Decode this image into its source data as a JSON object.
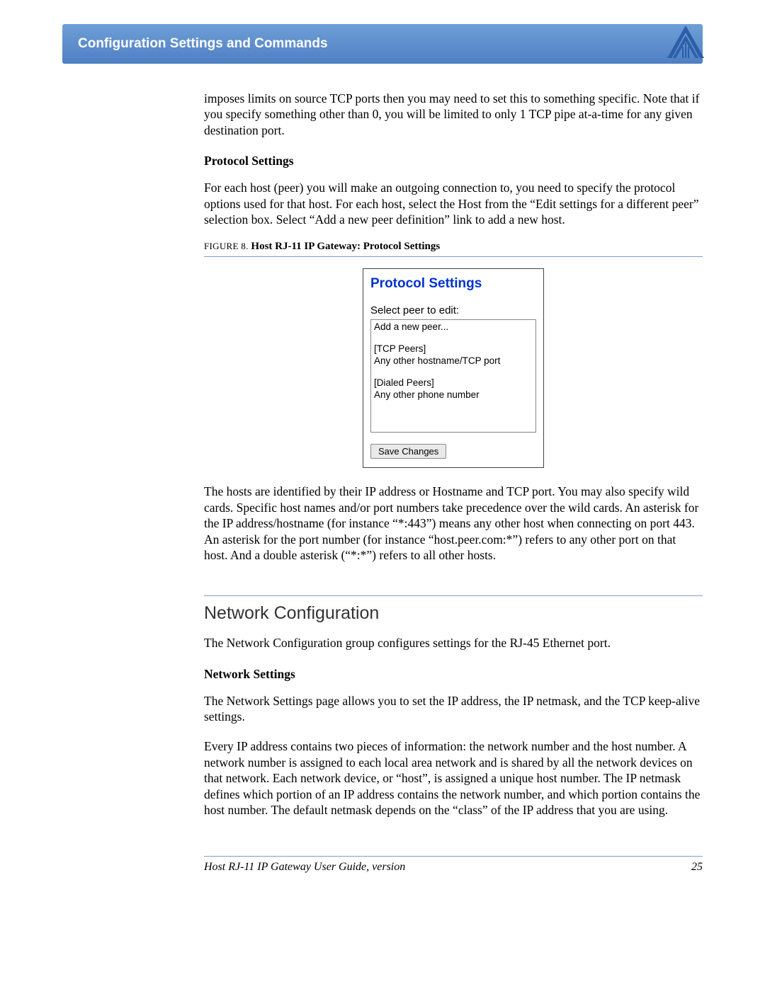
{
  "header": {
    "title": "Configuration Settings and Commands"
  },
  "body": {
    "intro_para": "imposes limits on source TCP ports then you may need to set this to something specific. Note that if you specify something other than 0, you will be limited to only 1 TCP pipe at-a-time for any given destination port.",
    "protocol_settings": {
      "heading": "Protocol Settings",
      "para": "For each host (peer) you will make an outgoing connection to, you need to specify the protocol options used for that host. For each host, select the Host from the “Edit settings for a different peer” selection box. Select “Add a new peer definition” link to add a new host.",
      "figure_label": "FIGURE 8.",
      "figure_title": "Host RJ-11 IP Gateway: Protocol Settings",
      "panel": {
        "title": "Protocol Settings",
        "select_label": "Select peer to edit:",
        "list": {
          "add": "Add a new peer...",
          "tcp_header": "[TCP Peers]",
          "tcp_item": " Any other hostname/TCP port",
          "dial_header": "[Dialed Peers]",
          "dial_item": " Any other phone number"
        },
        "save_button": "Save Changes"
      },
      "after_para": "The hosts are identified by their IP address or Hostname and TCP port. You may also specify wild cards. Specific host names and/or port numbers take precedence over the wild cards. An asterisk for the IP address/hostname (for instance “*:443”) means any other host when connecting on port 443. An asterisk for the port number (for instance “host.peer.com:*”) refers to any other port on that host. And a double asterisk (“*:*”) refers to all other hosts."
    },
    "network_configuration": {
      "section_title": "Network Configuration",
      "intro": "The Network Configuration group configures settings for the RJ-45 Ethernet port.",
      "network_settings_heading": "Network Settings",
      "ns_para1": "The Network Settings page allows you to set the IP address, the IP netmask, and the TCP keep-alive settings.",
      "ns_para2": "Every IP address contains two pieces of information: the network number and the host number. A network number is assigned to each local area network and is shared by all the network devices on that network. Each network device, or “host”, is assigned a unique host number. The IP netmask defines which portion of an IP address contains the network number, and which portion contains the host number. The default netmask depends on the “class” of the IP address that you are using."
    }
  },
  "footer": {
    "text": "Host RJ-11 IP Gateway User Guide, version",
    "page": "25"
  }
}
